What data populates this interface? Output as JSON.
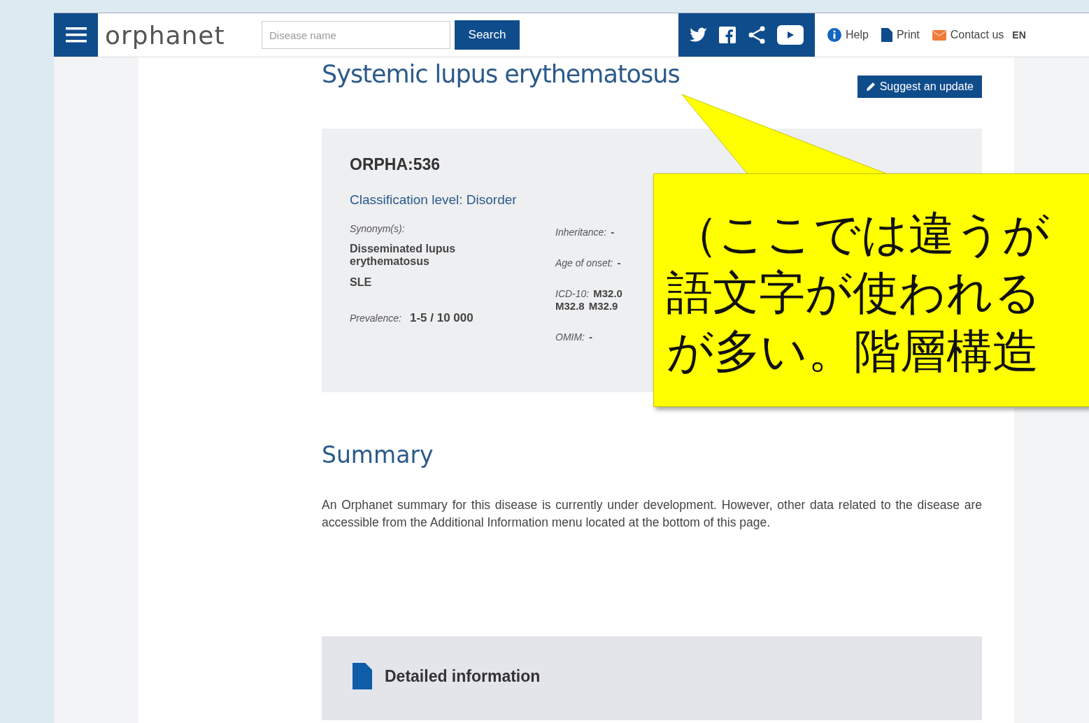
{
  "header": {
    "logo": "orphanet",
    "search": {
      "placeholder": "Disease name"
    },
    "search_button": "Search",
    "links": [
      {
        "kind": "help",
        "label": "Help"
      },
      {
        "kind": "print",
        "label": "Print"
      },
      {
        "kind": "contact",
        "label": "Contact us"
      }
    ],
    "language": "EN"
  },
  "disease": {
    "title": "Systemic lupus erythematosus",
    "suggest_button": "Suggest an update",
    "orpha_code": "ORPHA:536",
    "classification": "Classification level: Disorder",
    "synonyms_label": "Synonym(s):",
    "synonyms": [
      "Disseminated lupus erythematosus",
      "SLE"
    ],
    "prevalence": {
      "label": "Prevalence:",
      "value": "1-5 / 10 000"
    },
    "fields": [
      {
        "label": "Inheritance:",
        "values": [
          "-"
        ]
      },
      {
        "label": "Age of onset:",
        "values": [
          "-"
        ]
      },
      {
        "label": "ICD-10:",
        "values": [
          "M32.0",
          "M32.8",
          "M32.9"
        ]
      },
      {
        "label": "OMIM:",
        "values": [
          "-"
        ]
      }
    ]
  },
  "summary": {
    "heading": "Summary",
    "text": "An Orphanet summary for this disease is currently under development. However, other data related to the disease are accessible from the Additional Information menu located at the bottom of this page."
  },
  "detailed": {
    "heading": "Detailed information"
  },
  "callout": {
    "lines": [
      "（ここでは違うが",
      "語文字が使われる",
      "が多い。階層構造"
    ]
  }
}
